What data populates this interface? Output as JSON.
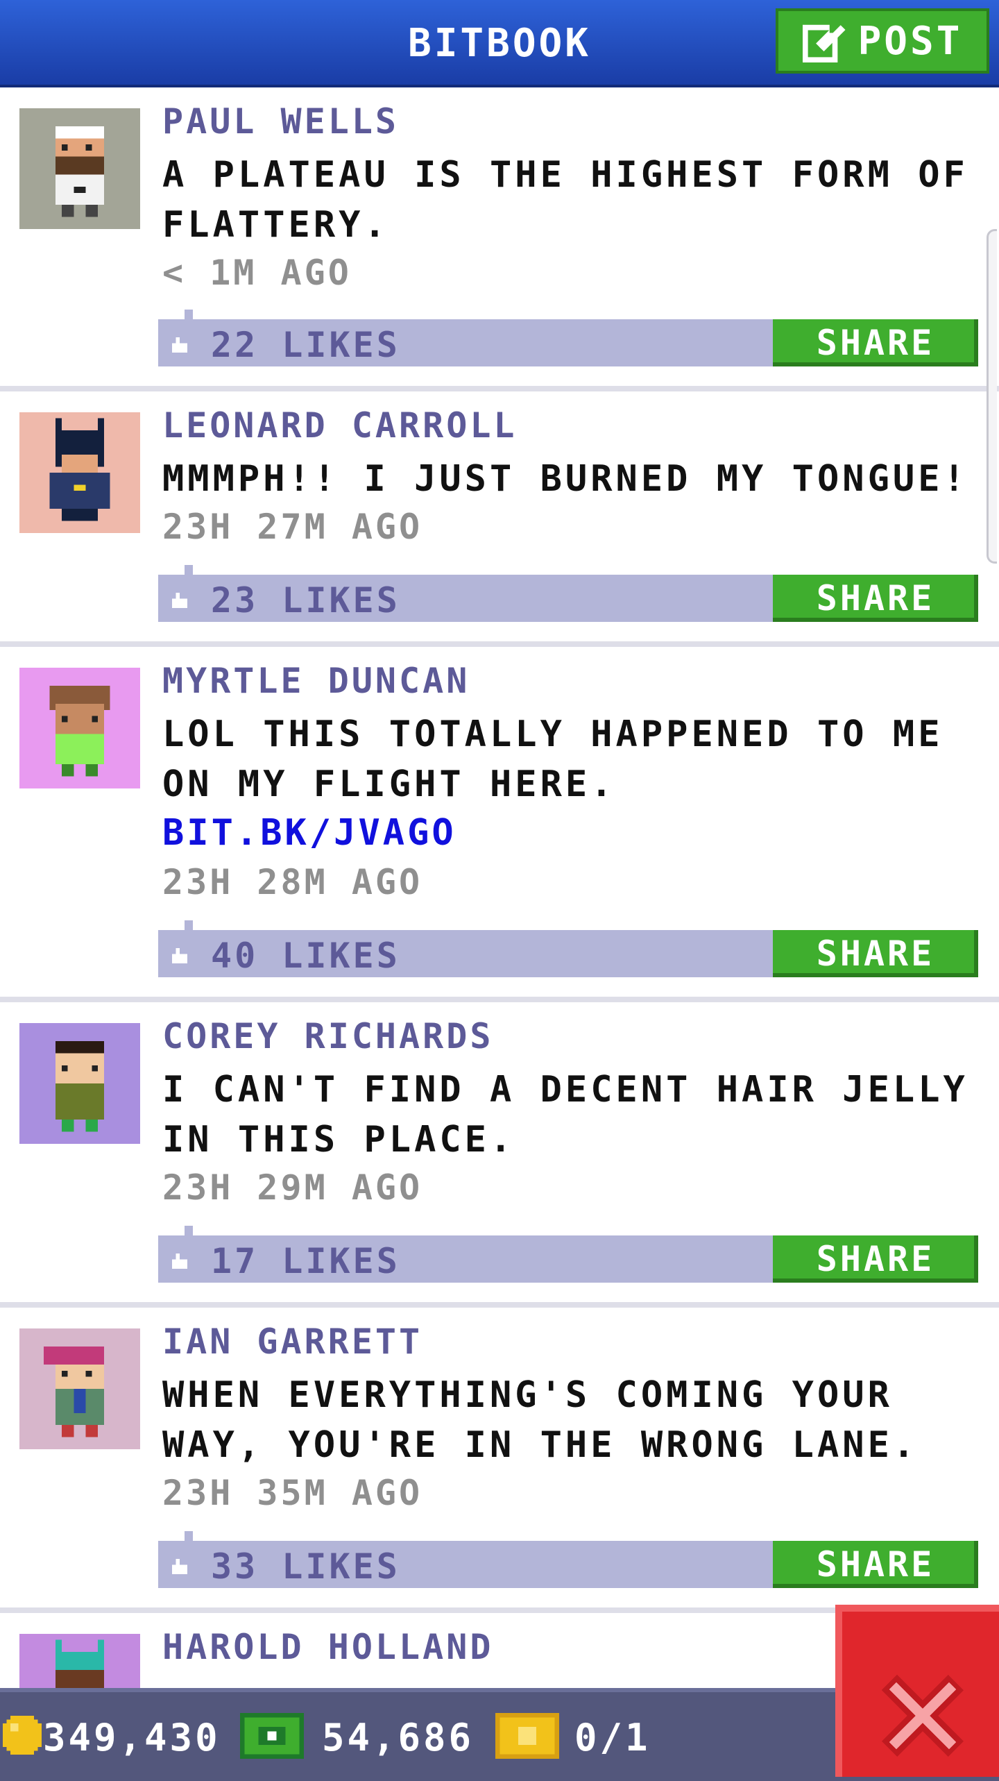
{
  "header": {
    "title": "BITBOOK",
    "post_label": "POST"
  },
  "posts": [
    {
      "name": "PAUL WELLS",
      "message": "A PLATEAU IS THE HIGHEST FORM OF FLATTERY.",
      "link": "",
      "time": "< 1M AGO",
      "likes": "22 LIKES",
      "share": "SHARE",
      "avatar_bg": "#a3a597"
    },
    {
      "name": "LEONARD CARROLL",
      "message": "MMMPH!! I JUST BURNED MY TONGUE!",
      "link": "",
      "time": "23H 27M AGO",
      "likes": "23 LIKES",
      "share": "SHARE",
      "avatar_bg": "#efb9ab"
    },
    {
      "name": "MYRTLE DUNCAN",
      "message": "LOL THIS TOTALLY HAPPENED TO ME ON MY FLIGHT HERE.",
      "link": "BIT.BK/JVAGO",
      "time": "23H 28M AGO",
      "likes": "40 LIKES",
      "share": "SHARE",
      "avatar_bg": "#e89af0"
    },
    {
      "name": "COREY RICHARDS",
      "message": "I CAN'T FIND A DECENT HAIR JELLY IN THIS PLACE.",
      "link": "",
      "time": "23H 29M AGO",
      "likes": "17 LIKES",
      "share": "SHARE",
      "avatar_bg": "#a98fdf"
    },
    {
      "name": "IAN GARRETT",
      "message": "WHEN EVERYTHING'S COMING YOUR WAY, YOU'RE IN THE WRONG LANE.",
      "link": "",
      "time": "23H 35M AGO",
      "likes": "33 LIKES",
      "share": "SHARE",
      "avatar_bg": "#d7b6cb"
    },
    {
      "name": "HAROLD HOLLAND",
      "message": "",
      "link": "",
      "time": "",
      "likes": "",
      "share": "",
      "avatar_bg": "#c38be0"
    }
  ],
  "bottom_bar": {
    "coins": "349,430",
    "bux": "54,686",
    "tickets": "0/1"
  },
  "colors": {
    "header_blue": "#2a55c8",
    "accent_green": "#3fae2e",
    "name_purple": "#5d5a98",
    "like_bar": "#b3b5d8",
    "link_blue": "#1010dd",
    "close_red": "#e0262c"
  },
  "icons": {
    "post": "edit-icon",
    "like": "thumbs-up-icon",
    "coin": "coin-icon",
    "bux": "bux-icon",
    "ticket": "ticket-icon",
    "close": "close-icon"
  }
}
